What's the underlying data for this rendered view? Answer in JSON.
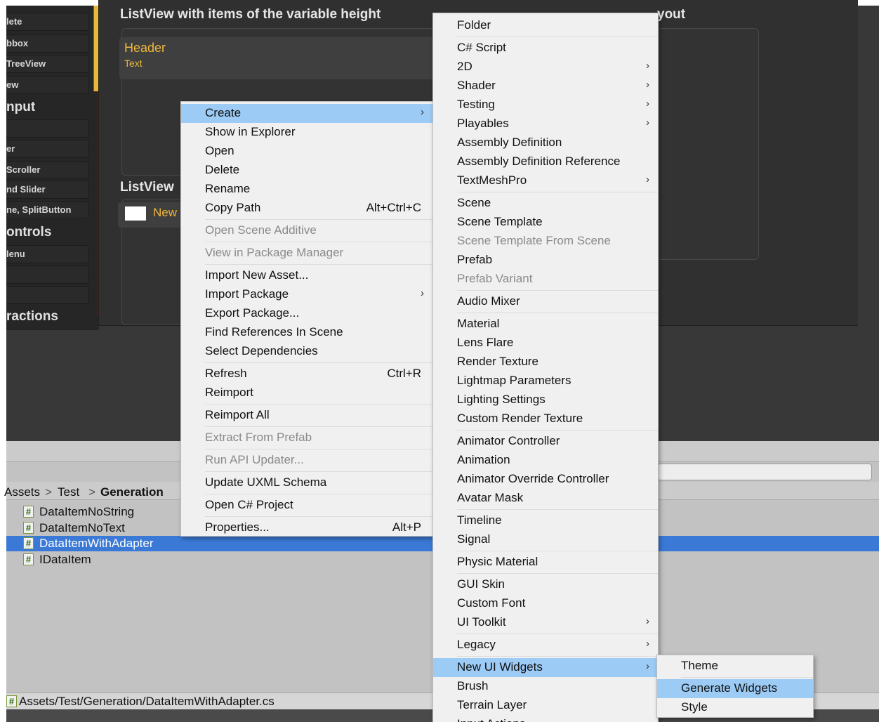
{
  "sidebar": {
    "items": [
      "lete",
      "bbox",
      "TreeView",
      "ew",
      "",
      "er",
      " Scroller",
      "nd Slider",
      "ne, SplitButton",
      "lenu",
      "",
      ""
    ],
    "headings": [
      "nput",
      "ontrols",
      "ractions"
    ]
  },
  "panel": {
    "title1": "ListView with items of the variable height",
    "title1_tail": "yout",
    "title2": "ListView",
    "header_text": "Header",
    "header_sub": "Text",
    "new_item_text": "New"
  },
  "breadcrumb": {
    "parts": [
      "Assets",
      "Test",
      "Generation"
    ],
    "separator": ">"
  },
  "files": [
    {
      "name": "DataItemNoString",
      "selected": false
    },
    {
      "name": "DataItemNoText",
      "selected": false
    },
    {
      "name": "DataItemWithAdapter",
      "selected": true
    },
    {
      "name": "IDataItem",
      "selected": false
    }
  ],
  "file_icon_glyph": "#",
  "status_path": "Assets/Test/Generation/DataItemWithAdapter.cs",
  "context_menu": [
    {
      "label": "Create",
      "arrow": true,
      "highlight": true
    },
    {
      "label": "Show in Explorer"
    },
    {
      "label": "Open"
    },
    {
      "label": "Delete"
    },
    {
      "label": "Rename"
    },
    {
      "label": "Copy Path",
      "shortcut": "Alt+Ctrl+C"
    },
    {
      "sep": true
    },
    {
      "label": "Open Scene Additive",
      "disabled": true
    },
    {
      "sep": true
    },
    {
      "label": "View in Package Manager",
      "disabled": true
    },
    {
      "sep": true
    },
    {
      "label": "Import New Asset..."
    },
    {
      "label": "Import Package",
      "arrow": true
    },
    {
      "label": "Export Package..."
    },
    {
      "label": "Find References In Scene"
    },
    {
      "label": "Select Dependencies"
    },
    {
      "sep": true
    },
    {
      "label": "Refresh",
      "shortcut": "Ctrl+R"
    },
    {
      "label": "Reimport"
    },
    {
      "sep": true
    },
    {
      "label": "Reimport All"
    },
    {
      "sep": true
    },
    {
      "label": "Extract From Prefab",
      "disabled": true
    },
    {
      "sep": true
    },
    {
      "label": "Run API Updater...",
      "disabled": true
    },
    {
      "sep": true
    },
    {
      "label": "Update UXML Schema"
    },
    {
      "sep": true
    },
    {
      "label": "Open C# Project"
    },
    {
      "sep": true
    },
    {
      "label": "Properties...",
      "shortcut": "Alt+P"
    }
  ],
  "create_menu": [
    {
      "label": "Folder"
    },
    {
      "sep": true
    },
    {
      "label": "C# Script"
    },
    {
      "label": "2D",
      "arrow": true
    },
    {
      "label": "Shader",
      "arrow": true
    },
    {
      "label": "Testing",
      "arrow": true
    },
    {
      "label": "Playables",
      "arrow": true
    },
    {
      "label": "Assembly Definition"
    },
    {
      "label": "Assembly Definition Reference"
    },
    {
      "label": "TextMeshPro",
      "arrow": true
    },
    {
      "sep": true
    },
    {
      "label": "Scene"
    },
    {
      "label": "Scene Template"
    },
    {
      "label": "Scene Template From Scene",
      "disabled": true
    },
    {
      "label": "Prefab"
    },
    {
      "label": "Prefab Variant",
      "disabled": true
    },
    {
      "sep": true
    },
    {
      "label": "Audio Mixer"
    },
    {
      "sep": true
    },
    {
      "label": "Material"
    },
    {
      "label": "Lens Flare"
    },
    {
      "label": "Render Texture"
    },
    {
      "label": "Lightmap Parameters"
    },
    {
      "label": "Lighting Settings"
    },
    {
      "label": "Custom Render Texture"
    },
    {
      "sep": true
    },
    {
      "label": "Animator Controller"
    },
    {
      "label": "Animation"
    },
    {
      "label": "Animator Override Controller"
    },
    {
      "label": "Avatar Mask"
    },
    {
      "sep": true
    },
    {
      "label": "Timeline"
    },
    {
      "label": "Signal"
    },
    {
      "sep": true
    },
    {
      "label": "Physic Material"
    },
    {
      "sep": true
    },
    {
      "label": "GUI Skin"
    },
    {
      "label": "Custom Font"
    },
    {
      "label": "UI Toolkit",
      "arrow": true
    },
    {
      "sep": true
    },
    {
      "label": "Legacy",
      "arrow": true
    },
    {
      "sep": true
    },
    {
      "label": "New UI Widgets",
      "arrow": true,
      "highlight": true
    },
    {
      "label": "Brush"
    },
    {
      "label": "Terrain Layer"
    },
    {
      "label": "Input Actions"
    }
  ],
  "widgets_menu": [
    {
      "label": "Theme"
    },
    {
      "sep": true
    },
    {
      "label": "Generate Widgets",
      "highlight": true
    },
    {
      "label": "Style"
    }
  ],
  "arrow_glyph": "›"
}
